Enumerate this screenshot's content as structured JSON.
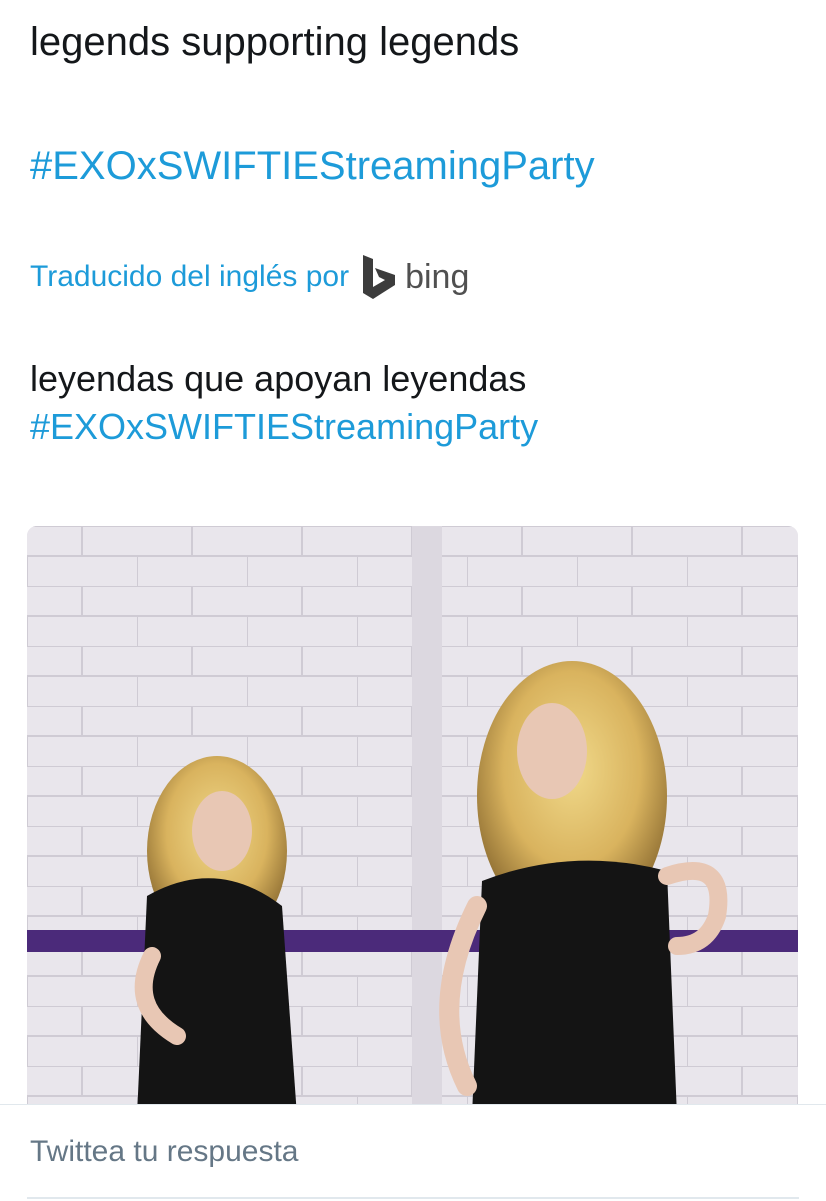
{
  "tweet": {
    "text": "legends supporting legends",
    "hashtag": "#EXOxSWIFTIEStreamingParty"
  },
  "translation": {
    "label": "Traducido del inglés por",
    "provider": "bing",
    "text": "leyendas que apoyan leyendas",
    "hashtag": "#EXOxSWIFTIEStreamingParty"
  },
  "media": {
    "description": "photo of a woman in a black dress posing in front of a mirror"
  },
  "reply": {
    "placeholder": "Twittea tu respuesta"
  },
  "colors": {
    "link": "#1d9bd9",
    "text": "#14171a",
    "muted": "#657786",
    "stripe": "#4b2a7a"
  }
}
